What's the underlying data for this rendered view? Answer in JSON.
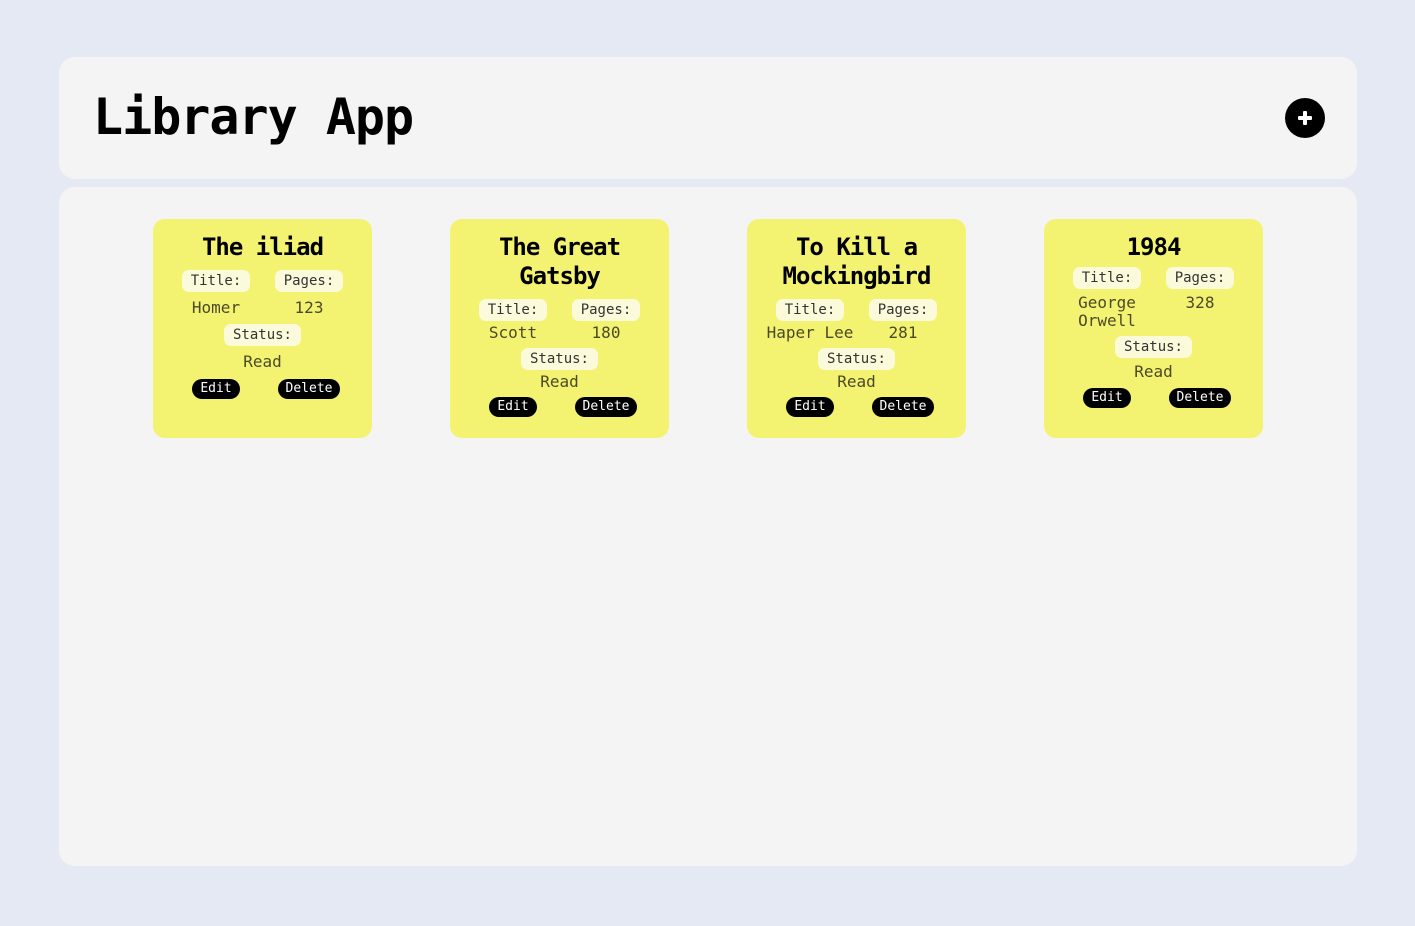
{
  "header": {
    "title": "Library App",
    "add_button_label": "+"
  },
  "labels": {
    "title": "Title:",
    "pages": "Pages:",
    "status": "Status:",
    "edit": "Edit",
    "delete": "Delete"
  },
  "books": [
    {
      "name": "The iliad",
      "title": "Homer",
      "pages": "123",
      "status": "Read"
    },
    {
      "name": "The Great Gatsby",
      "title": "Scott",
      "pages": "180",
      "status": "Read"
    },
    {
      "name": "To Kill a Mockingbird",
      "title": "Haper Lee",
      "pages": "281",
      "status": "Read"
    },
    {
      "name": "1984",
      "title": "George Orwell",
      "pages": "328",
      "status": "Read"
    }
  ],
  "colors": {
    "card_background": "#f4f271",
    "page_background": "#e5e9f3",
    "panel_background": "#f4f4f4",
    "button_background": "#000000"
  }
}
